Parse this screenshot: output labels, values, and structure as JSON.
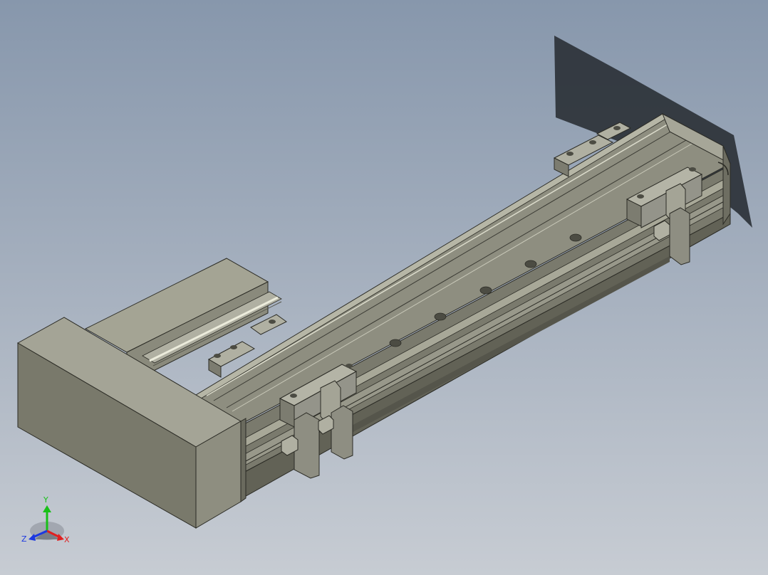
{
  "view": {
    "background_top": "#8797ac",
    "background_bottom": "#c7ccd3",
    "model_color": "#8a8a7c",
    "shadow_color": "#2c3238"
  },
  "triad": {
    "x_label": "X",
    "y_label": "Y",
    "z_label": "Z",
    "x_color": "#e02020",
    "y_color": "#18c018",
    "z_color": "#1c38e0"
  }
}
